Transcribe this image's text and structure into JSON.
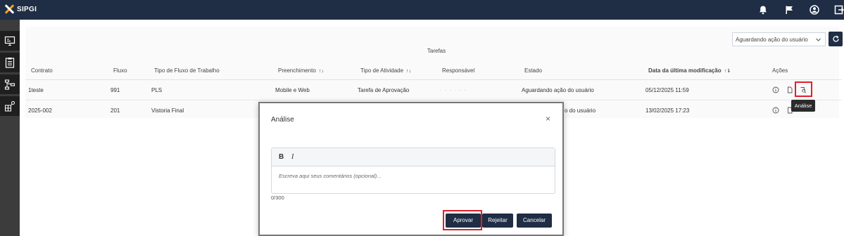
{
  "app": {
    "name": "SIPGI"
  },
  "filter": {
    "status_value": "Aguardando ação do usuário"
  },
  "table": {
    "title": "Tarefas",
    "headers": {
      "contrato": "Contrato",
      "fluxo": "Fluxo",
      "tipo_fluxo": "Tipo de Fluxo de Trabalho",
      "preenchimento": "Preenchimento",
      "tipo_atividade": "Tipo de Atividade",
      "responsavel": "Responsável",
      "estado": "Estado",
      "data": "Data da última modificação",
      "acoes": "Ações"
    },
    "rows": [
      {
        "contrato": "1teste",
        "fluxo": "991",
        "tipo_fluxo": "PLS",
        "preenchimento": "Mobile e Web",
        "tipo_atividade": "Tarefa de Aprovação",
        "estado": "Aguardando ação do usuário",
        "data": "05/12/2025 11:59"
      },
      {
        "contrato": "2025-002",
        "fluxo": "201",
        "tipo_fluxo": "Vistoria Final",
        "estado_partial": "o do usuário",
        "data": "13/02/2025 17:23"
      }
    ]
  },
  "tooltip": {
    "text": "Análise"
  },
  "modal": {
    "title": "Análise",
    "close": "×",
    "bold": "B",
    "italic": "I",
    "placeholder": "Escreva aqui seus comentários (opcional)...",
    "counter": "0/300",
    "buttons": {
      "approve": "Aprovar",
      "reject": "Rejeitar",
      "cancel": "Cancelar"
    }
  },
  "colors": {
    "topbar": "#1f2d45",
    "button": "#1f2d45",
    "highlight": "#e0202a",
    "logo_accent": "#f0a21e"
  }
}
